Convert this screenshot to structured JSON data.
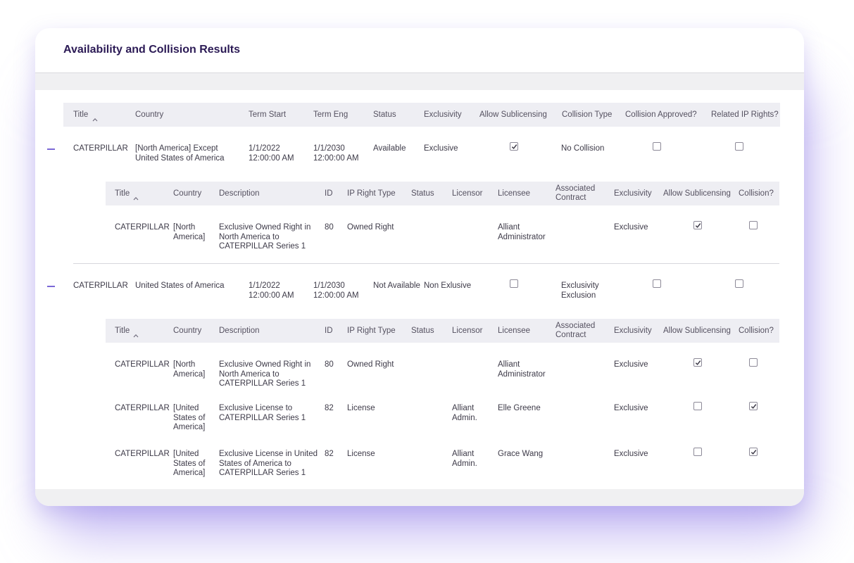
{
  "title": "Availability and Collision Results",
  "main_headers": {
    "title": "Title",
    "country": "Country",
    "term_start": "Term Start",
    "term_end": "Term Eng",
    "status": "Status",
    "exclusivity": "Exclusivity",
    "allow_sublicensing": "Allow Sublicensing",
    "collision_type": "Collision Type",
    "collision_approved": "Collision Approved?",
    "related_ip": "Related IP Rights?"
  },
  "sub_headers": {
    "title": "Title",
    "country": "Country",
    "description": "Description",
    "id": "ID",
    "ip_right_type": "IP Right Type",
    "status": "Status",
    "licensor": "Licensor",
    "licensee": "Licensee",
    "associated_contract": "Associated Contract",
    "exclusivity": "Exclusivity",
    "allow_sublicensing": "Allow Sublicensing",
    "collision": "Collision?"
  },
  "groups": [
    {
      "title": "CATERPILLAR",
      "country": "[North America] Except United States of America",
      "term_start": "1/1/2022 12:00:00 AM",
      "term_end": "1/1/2030 12:00:00 AM",
      "status": "Available",
      "exclusivity": "Exclusive",
      "allow_sublicensing": true,
      "collision_type": "No Collision",
      "collision_approved": false,
      "related_ip": false,
      "rights": [
        {
          "title": "CATERPILLAR",
          "country": "[North America]",
          "description": "Exclusive Owned Right in North America to CATERPILLAR Series 1",
          "id": "80",
          "ip_right_type": "Owned Right",
          "status": "",
          "licensor": "",
          "licensee": "Alliant Administrator",
          "contract": "",
          "exclusivity": "Exclusive",
          "allow_sublicensing": true,
          "collision": false
        }
      ]
    },
    {
      "title": "CATERPILLAR",
      "country": "United States of America",
      "term_start": "1/1/2022 12:00:00 AM",
      "term_end": "1/1/2030 12:00:00 AM",
      "status": "Not Available",
      "exclusivity": "Non Exlusive",
      "allow_sublicensing": false,
      "collision_type": "Exclusivity Exclusion",
      "collision_approved": false,
      "related_ip": false,
      "rights": [
        {
          "title": "CATERPILLAR",
          "country": "[North America]",
          "description": "Exclusive Owned Right in North America to CATERPILLAR Series 1",
          "id": "80",
          "ip_right_type": "Owned Right",
          "status": "",
          "licensor": "",
          "licensee": "Alliant Administrator",
          "contract": "",
          "exclusivity": "Exclusive",
          "allow_sublicensing": true,
          "collision": false
        },
        {
          "title": "CATERPILLAR",
          "country": "[United States of America]",
          "description": "Exclusive License to CATERPILLAR Series 1",
          "id": "82",
          "ip_right_type": "License",
          "status": "",
          "licensor": "Alliant Admin.",
          "licensee": "Elle Greene",
          "contract": "",
          "exclusivity": "Exclusive",
          "allow_sublicensing": false,
          "collision": true
        },
        {
          "title": "CATERPILLAR",
          "country": "[United States of America]",
          "description": "Exclusive License in United States of America to CATERPILLAR Series 1",
          "id": "82",
          "ip_right_type": "License",
          "status": "",
          "licensor": "Alliant Admin.",
          "licensee": "Grace Wang",
          "contract": "",
          "exclusivity": "Exclusive",
          "allow_sublicensing": false,
          "collision": true
        }
      ]
    }
  ],
  "colors": {
    "title": "#2b1a55",
    "accent": "#7b68d6",
    "header_bg": "#eeeef3"
  }
}
